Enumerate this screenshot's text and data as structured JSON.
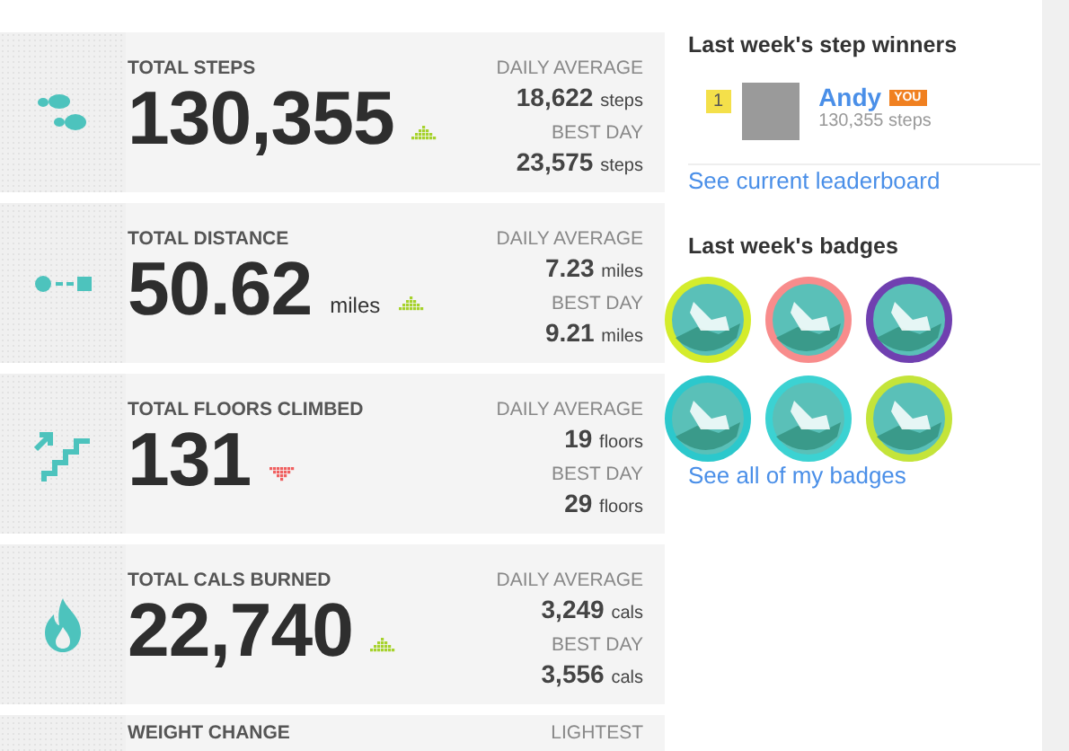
{
  "stats": [
    {
      "kind": "steps",
      "label": "TOTAL STEPS",
      "value": "130,355",
      "trend_up": true,
      "avg_label": "DAILY AVERAGE",
      "avg_value": "18,622",
      "avg_unit": "steps",
      "best_label": "BEST DAY",
      "best_value": "23,575",
      "best_unit": "steps"
    },
    {
      "kind": "distance",
      "label": "TOTAL DISTANCE",
      "value": "50.62",
      "unit": "miles",
      "trend_up": true,
      "avg_label": "DAILY AVERAGE",
      "avg_value": "7.23",
      "avg_unit": "miles",
      "best_label": "BEST DAY",
      "best_value": "9.21",
      "best_unit": "miles"
    },
    {
      "kind": "floors",
      "label": "TOTAL FLOORS CLIMBED",
      "value": "131",
      "trend_up": false,
      "avg_label": "DAILY AVERAGE",
      "avg_value": "19",
      "avg_unit": "floors",
      "best_label": "BEST DAY",
      "best_value": "29",
      "best_unit": "floors"
    },
    {
      "kind": "calories",
      "label": "TOTAL CALS BURNED",
      "value": "22,740",
      "trend_up": true,
      "avg_label": "DAILY AVERAGE",
      "avg_value": "3,249",
      "avg_unit": "cals",
      "best_label": "BEST DAY",
      "best_value": "3,556",
      "best_unit": "cals"
    },
    {
      "kind": "weight",
      "label": "WEIGHT CHANGE",
      "avg_label": "LIGHTEST"
    }
  ],
  "winners": {
    "title": "Last week's step winners",
    "entries": [
      {
        "rank": "1",
        "name": "Andy",
        "tag": "YOU",
        "steps": "130,355 steps"
      }
    ],
    "link": "See current leaderboard"
  },
  "badges": {
    "title": "Last week's badges",
    "items": [
      {
        "color": "#d4ec2c"
      },
      {
        "color": "#f88c8c"
      },
      {
        "color": "#7040b0"
      },
      {
        "color": "#2cc8cc"
      },
      {
        "color": "#3cd2d2"
      },
      {
        "color": "#c4e43a"
      }
    ],
    "link": "See all of my badges"
  }
}
